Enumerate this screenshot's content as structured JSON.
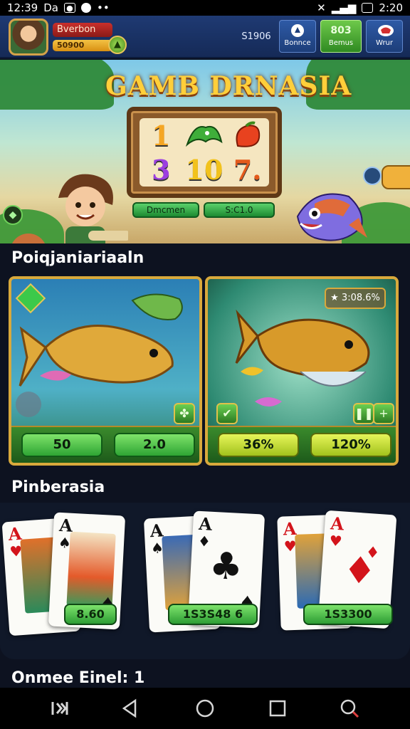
{
  "status_bar": {
    "time_left": "12:39",
    "carrier": "Da",
    "time_right": "2:20"
  },
  "header": {
    "player_name": "Bverbon",
    "player_xp": "50900",
    "balance": "S1906",
    "buttons": [
      {
        "label": "Bonnce",
        "icon": "gift-icon"
      },
      {
        "label": "Bemus",
        "value": "803"
      },
      {
        "label": "Wrur",
        "icon": "vip-icon"
      }
    ]
  },
  "banner": {
    "title": "GAMB DRNASIA",
    "reels": [
      "1",
      "",
      "",
      "3",
      "10",
      "7."
    ],
    "chip_left": "Dmcmen",
    "chip_right": "S:C1.0",
    "progress": 0.38
  },
  "section_fish": {
    "title": "Poiqjaniariaaln",
    "cards": [
      {
        "pills": [
          "50",
          "2.0"
        ]
      },
      {
        "rating": "3:08.6%",
        "pills": [
          "36%",
          "120%"
        ]
      }
    ]
  },
  "section_cards": {
    "title": "Pinberasia",
    "cards": [
      {
        "price": "8.60"
      },
      {
        "price": "1S3S48 6"
      },
      {
        "price": "1S3300"
      }
    ]
  },
  "footer_label": "Onmee Einel:  1",
  "colors": {
    "gold": "#d8a93c",
    "green": "#2ea534",
    "lime": "#a2c21c"
  }
}
